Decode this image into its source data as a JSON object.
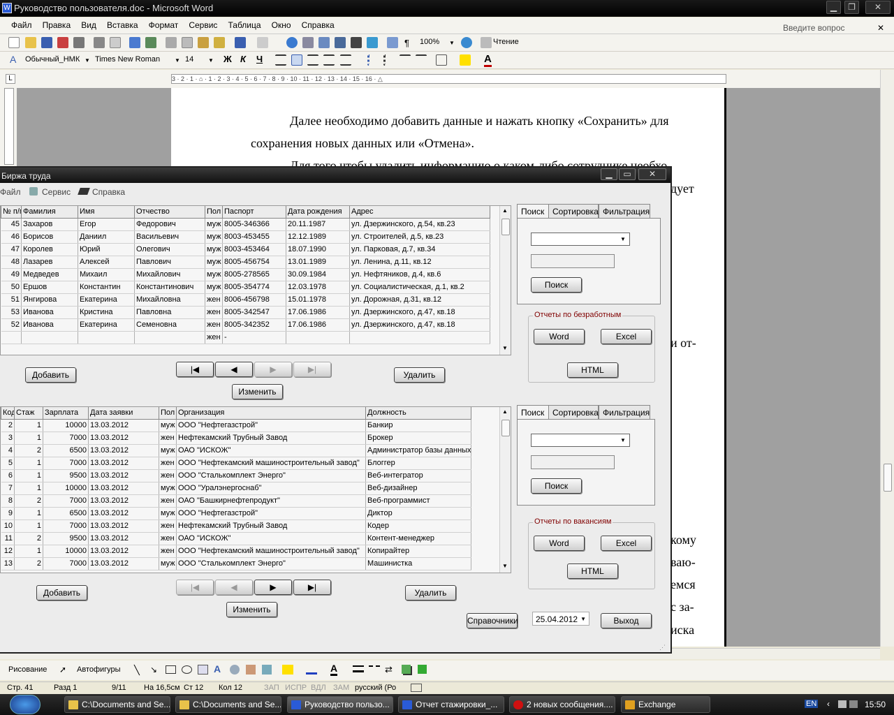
{
  "word": {
    "title": "Руководство пользователя.doc - Microsoft Word",
    "menu": [
      "Файл",
      "Правка",
      "Вид",
      "Вставка",
      "Формат",
      "Сервис",
      "Таблица",
      "Окно",
      "Справка"
    ],
    "ask": "Введите вопрос",
    "zoom": "100%",
    "read": "Чтение",
    "style": "Обычный_НМК",
    "font": "Times New Roman",
    "size": "14",
    "bold": "Ж",
    "italic": "К",
    "underline": "Ч",
    "ruler_text": "3 · 2 · 1 · ⌂ · 1 · 2 · 3 · 4 · 5 · 6 · 7 · 8 · 9 · 10 · 11 · 12 · 13 · 14 · 15 · 16 · △",
    "doc_lines": [
      "Далее необходимо добавить данные и нажать кнопку «Сохранить» для",
      "сохранения новых данных или «Отмена».",
      "Для того чтобы удалить информацию о каком-либо сотруднике необхо-",
      "дует",
      "и от-",
      "кому",
      "ваю-",
      "емся",
      "с за-",
      "иска"
    ],
    "drawbar": {
      "draw": "Рисование",
      "autoshapes": "Автофигуры"
    },
    "status": {
      "page": "Стр. 41",
      "section": "Разд 1",
      "pages": "9/11",
      "at": "На 16,5см",
      "line": "Ст 12",
      "col": "Кол 12",
      "rec": "ЗАП",
      "trk": "ИСПР",
      "ext": "ВДЛ",
      "ovr": "ЗАМ",
      "lang": "русский (Ро"
    }
  },
  "taskbar": {
    "items": [
      "C:\\Documents and Se...",
      "C:\\Documents and Se...",
      "Руководство пользо...",
      "Отчет стажировки_...",
      "2 новых сообщения....",
      "Exchange"
    ],
    "lang": "EN",
    "time": "15:50"
  },
  "app": {
    "title": "Биржа труда",
    "menu": {
      "file": "Файл",
      "service": "Сервис",
      "help": "Справка"
    },
    "grid1": {
      "headers": [
        "№ п/п",
        "Фамилия",
        "Имя",
        "Отчество",
        "Пол",
        "Паспорт",
        "Дата рождения",
        "Адрес"
      ],
      "rows": [
        [
          "45",
          "Захаров",
          "Егор",
          "Федорович",
          "муж",
          "8005-346366",
          "20.11.1987",
          "ул. Дзержинского, д.54, кв.23"
        ],
        [
          "46",
          "Борисов",
          "Даниил",
          "Васильевич",
          "муж",
          "8003-453455",
          "12.12.1989",
          "ул. Строителей, д.5, кв.23"
        ],
        [
          "47",
          "Королев",
          "Юрий",
          "Олегович",
          "муж",
          "8003-453464",
          "18.07.1990",
          "ул. Парковая, д.7, кв.34"
        ],
        [
          "48",
          "Лазарев",
          "Алексей",
          "Павлович",
          "муж",
          "8005-456754",
          "13.01.1989",
          "ул. Ленина, д.11, кв.12"
        ],
        [
          "49",
          "Медведев",
          "Михаил",
          "Михайлович",
          "муж",
          "8005-278565",
          "30.09.1984",
          "ул. Нефтяников, д.4, кв.6"
        ],
        [
          "50",
          "Ершов",
          "Константин",
          "Константинович",
          "муж",
          "8005-354774",
          "12.03.1978",
          "ул. Социалистическая, д.1, кв.2"
        ],
        [
          "51",
          "Янгирова",
          "Екатерина",
          "Михайловна",
          "жен",
          "8006-456798",
          "15.01.1978",
          "ул. Дорожная, д.31, кв.12"
        ],
        [
          "53",
          "Иванова",
          "Кристина",
          "Павловна",
          "жен",
          "8005-342547",
          "17.06.1986",
          "ул. Дзержинского, д.47, кв.18"
        ],
        [
          "52",
          "Иванова",
          "Екатерина",
          "Семеновна",
          "жен",
          "8005-342352",
          "17.06.1986",
          "ул. Дзержинского, д.47, кв.18"
        ],
        [
          "",
          "",
          "",
          "",
          "жен",
          "-",
          "",
          ""
        ]
      ]
    },
    "grid2": {
      "headers": [
        "Код",
        "Стаж",
        "Зарплата",
        "Дата заявки",
        "Пол",
        "Организация",
        "Должность"
      ],
      "rows": [
        [
          "2",
          "1",
          "10000",
          "13.03.2012",
          "муж",
          "ООО \"Нефтегазстрой\"",
          "Банкир"
        ],
        [
          "3",
          "1",
          "7000",
          "13.03.2012",
          "жен",
          "Нефтекамский Трубный Завод",
          "Брокер"
        ],
        [
          "4",
          "2",
          "6500",
          "13.03.2012",
          "муж",
          "ОАО \"ИСКОЖ\"",
          "Администратор базы данных"
        ],
        [
          "5",
          "1",
          "7000",
          "13.03.2012",
          "жен",
          "ООО \"Нефтекамский машиностроительный завод\"",
          "Блоггер"
        ],
        [
          "6",
          "1",
          "9500",
          "13.03.2012",
          "жен",
          "ООО \"Сталькомплект Энерго\"",
          "Веб-интегратор"
        ],
        [
          "7",
          "1",
          "10000",
          "13.03.2012",
          "муж",
          "ООО \"Уралэнергоснаб\"",
          "Веб-дизайнер"
        ],
        [
          "8",
          "2",
          "7000",
          "13.03.2012",
          "жен",
          "ОАО \"Башкирнефтепродукт\"",
          "Веб-программист"
        ],
        [
          "9",
          "1",
          "6500",
          "13.03.2012",
          "муж",
          "ООО \"Нефтегазстрой\"",
          "Диктор"
        ],
        [
          "10",
          "1",
          "7000",
          "13.03.2012",
          "жен",
          "Нефтекамский Трубный Завод",
          "Кодер"
        ],
        [
          "11",
          "2",
          "9500",
          "13.03.2012",
          "жен",
          "ОАО \"ИСКОЖ\"",
          "Контент-менеджер"
        ],
        [
          "12",
          "1",
          "10000",
          "13.03.2012",
          "жен",
          "ООО \"Нефтекамский машиностроительный завод\"",
          "Копирайтер"
        ],
        [
          "13",
          "2",
          "7000",
          "13.03.2012",
          "муж",
          "ООО \"Сталькомплект Энерго\"",
          "Машинистка"
        ]
      ]
    },
    "tabs": [
      "Поиск",
      "Сортировка",
      "Фильтрация"
    ],
    "search_btn": "Поиск",
    "add": "Добавить",
    "edit": "Изменить",
    "delete": "Удалить",
    "nav": [
      "|◀",
      "◀",
      "▶",
      "▶|"
    ],
    "report1": "Отчеты по безработным",
    "report2": "Отчеты по вакансиям",
    "word_btn": "Word",
    "excel_btn": "Excel",
    "html_btn": "HTML",
    "refs": "Справочники",
    "date": "25.04.2012",
    "exit": "Выход"
  }
}
